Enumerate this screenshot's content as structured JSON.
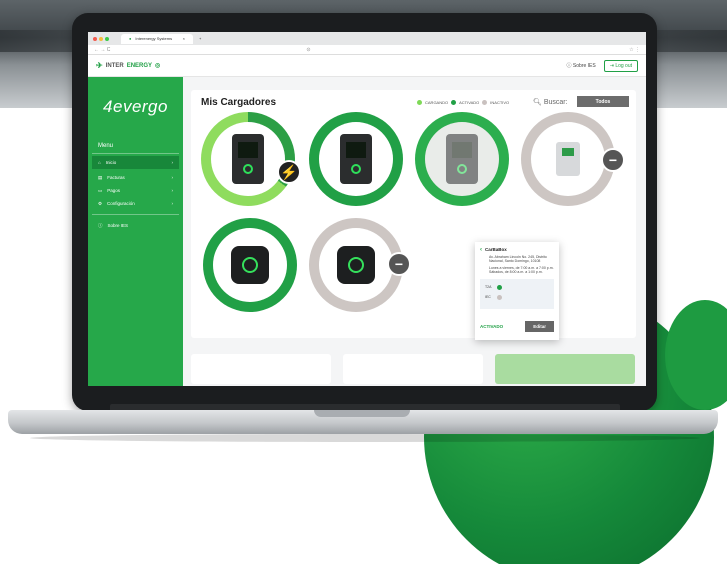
{
  "browser": {
    "tab_title": "Interenergy Systems",
    "tab_close": "×",
    "new_tab": "+",
    "nav": "← → C",
    "addr": "⊙",
    "addr_right": "☆ ⋮"
  },
  "header": {
    "brand_left": "INTER",
    "brand_right": "ENERGY",
    "about_label": "Sobre IES",
    "logout_label": "Log out"
  },
  "sidebar": {
    "logo_text": "4evergo",
    "menu_title": "Menu",
    "items": [
      {
        "label": "Inicio",
        "icon": "home-icon",
        "active": true
      },
      {
        "label": "Facturas",
        "icon": "invoice-icon",
        "active": false
      },
      {
        "label": "Pagos",
        "icon": "card-icon",
        "active": false
      },
      {
        "label": "Configuración",
        "icon": "gear-icon",
        "active": false
      }
    ],
    "about_label": "Sobre IES"
  },
  "main": {
    "title": "Mis Cargadores",
    "legend": [
      {
        "label": "CARGANDO",
        "color": "#7ed957"
      },
      {
        "label": "ACTIVADO",
        "color": "#21a046"
      },
      {
        "label": "INACTIVO",
        "color": "#c9c1bf"
      }
    ],
    "search_label": "Buscar:",
    "filter_label": "Todos"
  },
  "popup": {
    "title": "CarBaBox",
    "address": "Av. Abraham Lincoln No. 245, Distrito Nacional, Santo Domingo, 10108",
    "hours": "Lunes a viernes, de 7:00 a.m. a 7:00 p.m. Sábados, de 8:00 a.m. a 1:00 p.m.",
    "rows": [
      "T2A",
      "IEC"
    ],
    "status": "ACTIVADO",
    "edit_label": "Editar"
  },
  "colors": {
    "accent": "#21a046",
    "sidebar": "#26a84a",
    "charging": "#7ed957",
    "inactive": "#c9c1bf"
  }
}
